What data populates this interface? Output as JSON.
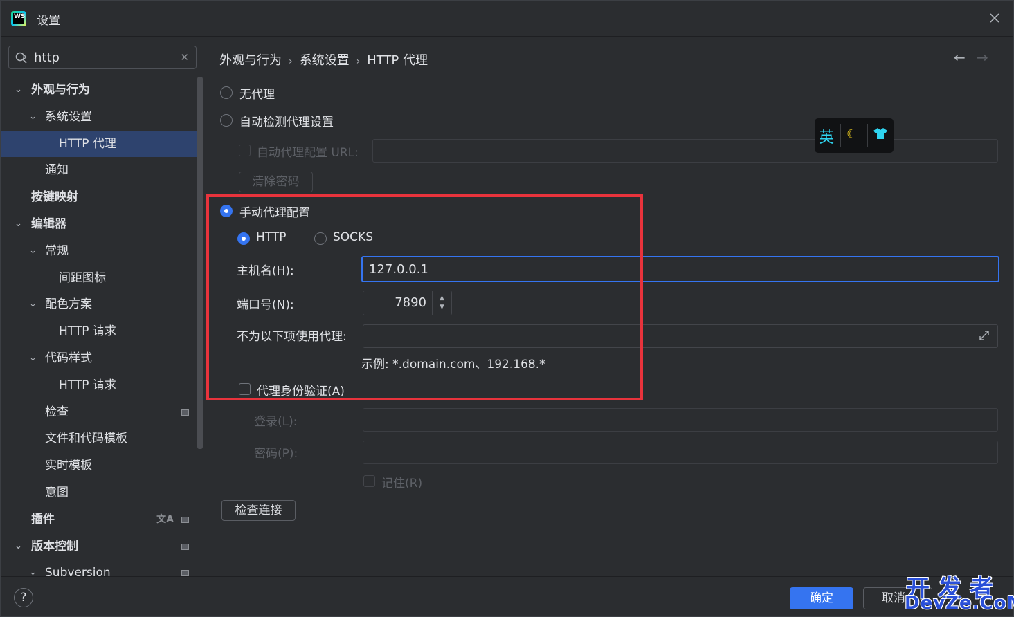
{
  "window": {
    "title": "设置",
    "logo_text": "WS"
  },
  "search": {
    "value": "http"
  },
  "sidebar": {
    "items": [
      {
        "label": "外观与行为",
        "chev": "⌄"
      },
      {
        "label": "系统设置",
        "chev": "⌄"
      },
      {
        "label": "HTTP 代理"
      },
      {
        "label": "通知"
      },
      {
        "label": "按键映射"
      },
      {
        "label": "编辑器",
        "chev": "⌄"
      },
      {
        "label": "常规",
        "chev": "⌄"
      },
      {
        "label": "间距图标"
      },
      {
        "label": "配色方案",
        "chev": "⌄"
      },
      {
        "label": "HTTP 请求"
      },
      {
        "label": "代码样式",
        "chev": "⌄"
      },
      {
        "label": "HTTP 请求"
      },
      {
        "label": "检查"
      },
      {
        "label": "文件和代码模板"
      },
      {
        "label": "实时模板"
      },
      {
        "label": "意图"
      },
      {
        "label": "插件"
      },
      {
        "label": "版本控制",
        "chev": "⌄"
      },
      {
        "label": "Subversion",
        "chev": "⌄"
      }
    ]
  },
  "breadcrumb": {
    "level1": "外观与行为",
    "level2": "系统设置",
    "level3": "HTTP 代理"
  },
  "proxy": {
    "no_proxy": "无代理",
    "auto_detect": "自动检测代理设置",
    "auto_url_label": "自动代理配置 URL:",
    "clear_password": "清除密码",
    "manual": "手动代理配置",
    "http": "HTTP",
    "socks": "SOCKS",
    "host_label": "主机名(H):",
    "host_value": "127.0.0.1",
    "port_label": "端口号(N):",
    "port_value": "7890",
    "no_proxy_for_label": "不为以下项使用代理:",
    "example": "示例: *.domain.com、192.168.*",
    "auth_label": "代理身份验证(A)",
    "login_label": "登录(L):",
    "password_label": "密码(P):",
    "remember_label": "记住(R)",
    "check_connection": "检查连接"
  },
  "ime": {
    "lang": "英",
    "moon": "☾",
    "shirt": "👕"
  },
  "footer": {
    "help": "?",
    "ok": "确定",
    "cancel": "取消"
  },
  "watermark": {
    "line1": "开发者",
    "line2": "DevZe.CoM"
  },
  "colors": {
    "accent": "#3574f0",
    "highlight": "#e8333c",
    "selected": "#2e436e"
  }
}
